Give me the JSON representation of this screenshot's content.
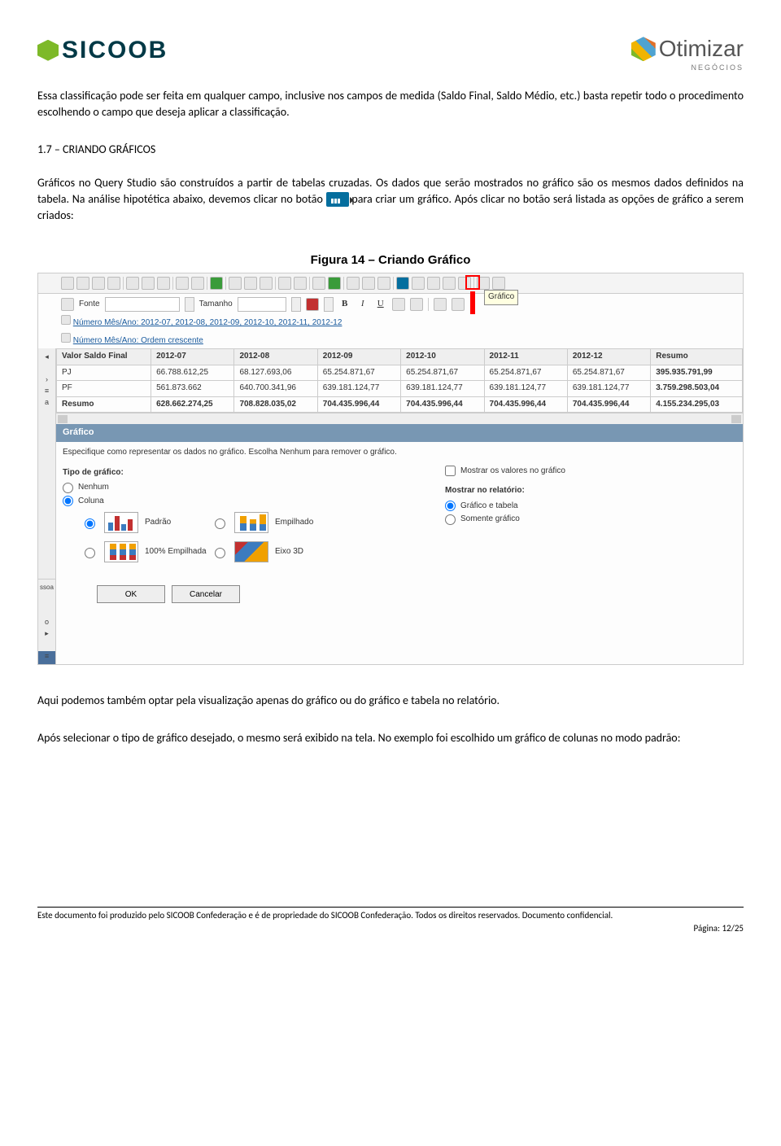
{
  "header": {
    "logo_left": "SICOOB",
    "logo_right": "Otimizar",
    "logo_right_sub": "NEGÓCIOS"
  },
  "para1": "Essa classificação pode ser feita em qualquer campo, inclusive nos campos de medida (Saldo Final, Saldo Médio, etc.) basta repetir todo o procedimento escolhendo o campo que deseja aplicar a classificação.",
  "section_heading": "1.7 – CRIANDO GRÁFICOS",
  "para2a": "Gráficos no Query Studio são construídos a partir de tabelas cruzadas. Os dados que serão mostrados no gráfico são os mesmos dados definidos na tabela. Na análise hipotética abaixo, devemos clicar no botão ",
  "para2b": " para criar um gráfico. Após clicar no botão será listada as opções de gráfico a serem criados:",
  "figure_caption": "Figura 14 – Criando Gráfico",
  "shot": {
    "tooltip": "Gráfico",
    "fmt": {
      "font_label": "Fonte",
      "font_value": "",
      "size_label": "Tamanho",
      "size_value": "",
      "b": "B",
      "i": "I",
      "u": "U"
    },
    "filter_prefix": "Número Mês/Ano: ",
    "filter_values": "2012-07, 2012-08, 2012-09, 2012-10, 2012-11, 2012-12",
    "sort_label": "Número Mês/Ano: Ordem crescente",
    "table": {
      "headers": [
        "Valor Saldo Final",
        "2012-07",
        "2012-08",
        "2012-09",
        "2012-10",
        "2012-11",
        "2012-12",
        "Resumo"
      ],
      "rows": [
        [
          "PJ",
          "66.788.612,25",
          "68.127.693,06",
          "65.254.871,67",
          "65.254.871,67",
          "65.254.871,67",
          "65.254.871,67",
          "395.935.791,99"
        ],
        [
          "PF",
          "561.873.662",
          "640.700.341,96",
          "639.181.124,77",
          "639.181.124,77",
          "639.181.124,77",
          "639.181.124,77",
          "3.759.298.503,04"
        ],
        [
          "Resumo",
          "628.662.274,25",
          "708.828.035,02",
          "704.435.996,44",
          "704.435.996,44",
          "704.435.996,44",
          "704.435.996,44",
          "4.155.234.295,03"
        ]
      ]
    },
    "panel": {
      "title": "Gráfico",
      "desc": "Especifique como representar os dados no gráfico. Escolha Nenhum para remover o gráfico.",
      "type_label": "Tipo de gráfico:",
      "opt_none": "Nenhum",
      "opt_column": "Coluna",
      "chart_padrao": "Padrão",
      "chart_empilhado": "Empilhado",
      "chart_100": "100% Empilhada",
      "chart_eixo3d": "Eixo 3D",
      "show_values": "Mostrar os valores no gráfico",
      "show_in_report": "Mostrar no relatório:",
      "opt_both": "Gráfico e tabela",
      "opt_chart_only": "Somente gráfico",
      "ok": "OK",
      "cancel": "Cancelar"
    },
    "sidebar_labels": [
      "",
      "",
      "",
      "a",
      "",
      "ssoa",
      "",
      "o"
    ]
  },
  "para3": "Aqui podemos também optar pela visualização apenas do gráfico ou do gráfico e tabela no relatório.",
  "para4": "Após selecionar o tipo de gráfico desejado, o mesmo será exibido na tela. No exemplo foi escolhido um gráfico de colunas no modo padrão:",
  "footer": {
    "line": "Este documento foi produzido pelo SICOOB Confederação e é de propriedade do SICOOB Confederação. Todos os direitos reservados. Documento confidencial.",
    "page": "Página: 12/25"
  }
}
